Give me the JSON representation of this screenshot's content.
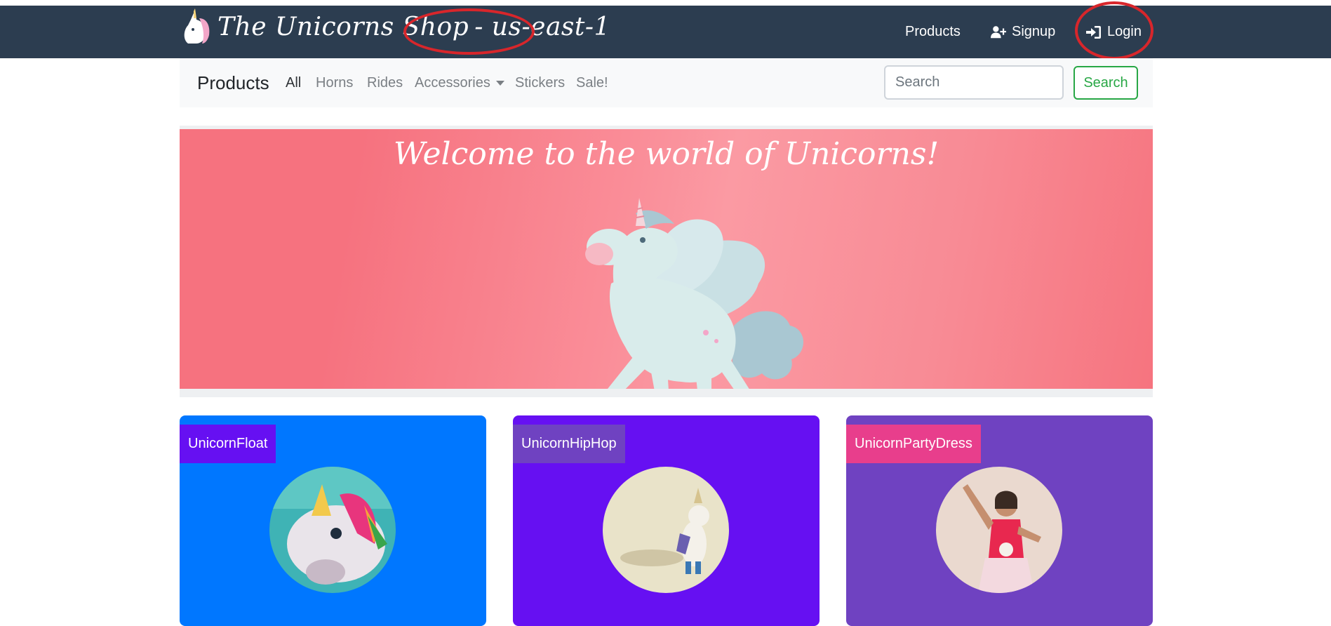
{
  "header": {
    "brand_title": "The Unicorns Shop",
    "region": "- us-east-1",
    "nav": [
      {
        "label": "Products",
        "icon": "none"
      },
      {
        "label": "Signup",
        "icon": "user-plus-icon"
      },
      {
        "label": "Login",
        "icon": "sign-in-icon"
      }
    ],
    "background_color": "#2c3d50"
  },
  "subnav": {
    "title": "Products",
    "items": [
      {
        "label": "All",
        "active": true
      },
      {
        "label": "Horns",
        "active": false
      },
      {
        "label": "Rides",
        "active": false
      },
      {
        "label": "Accessories",
        "active": false,
        "dropdown": true
      },
      {
        "label": "Stickers",
        "active": false
      },
      {
        "label": "Sale!",
        "active": false
      }
    ],
    "search": {
      "placeholder": "Search",
      "value": ""
    },
    "search_button_label": "Search"
  },
  "hero": {
    "title": "Welcome to the world of Unicorns!",
    "background_color": "#f6727f"
  },
  "products": [
    {
      "name": "UnicornFloat",
      "card_color": "#0077ff",
      "label_color": "#6610f2"
    },
    {
      "name": "UnicornHipHop",
      "card_color": "#6610f2",
      "label_color": "#6f42c1"
    },
    {
      "name": "UnicornPartyDress",
      "card_color": "#6f42c1",
      "label_color": "#e83e8c"
    }
  ],
  "annotations": {
    "highlight_color": "#d8262b"
  }
}
